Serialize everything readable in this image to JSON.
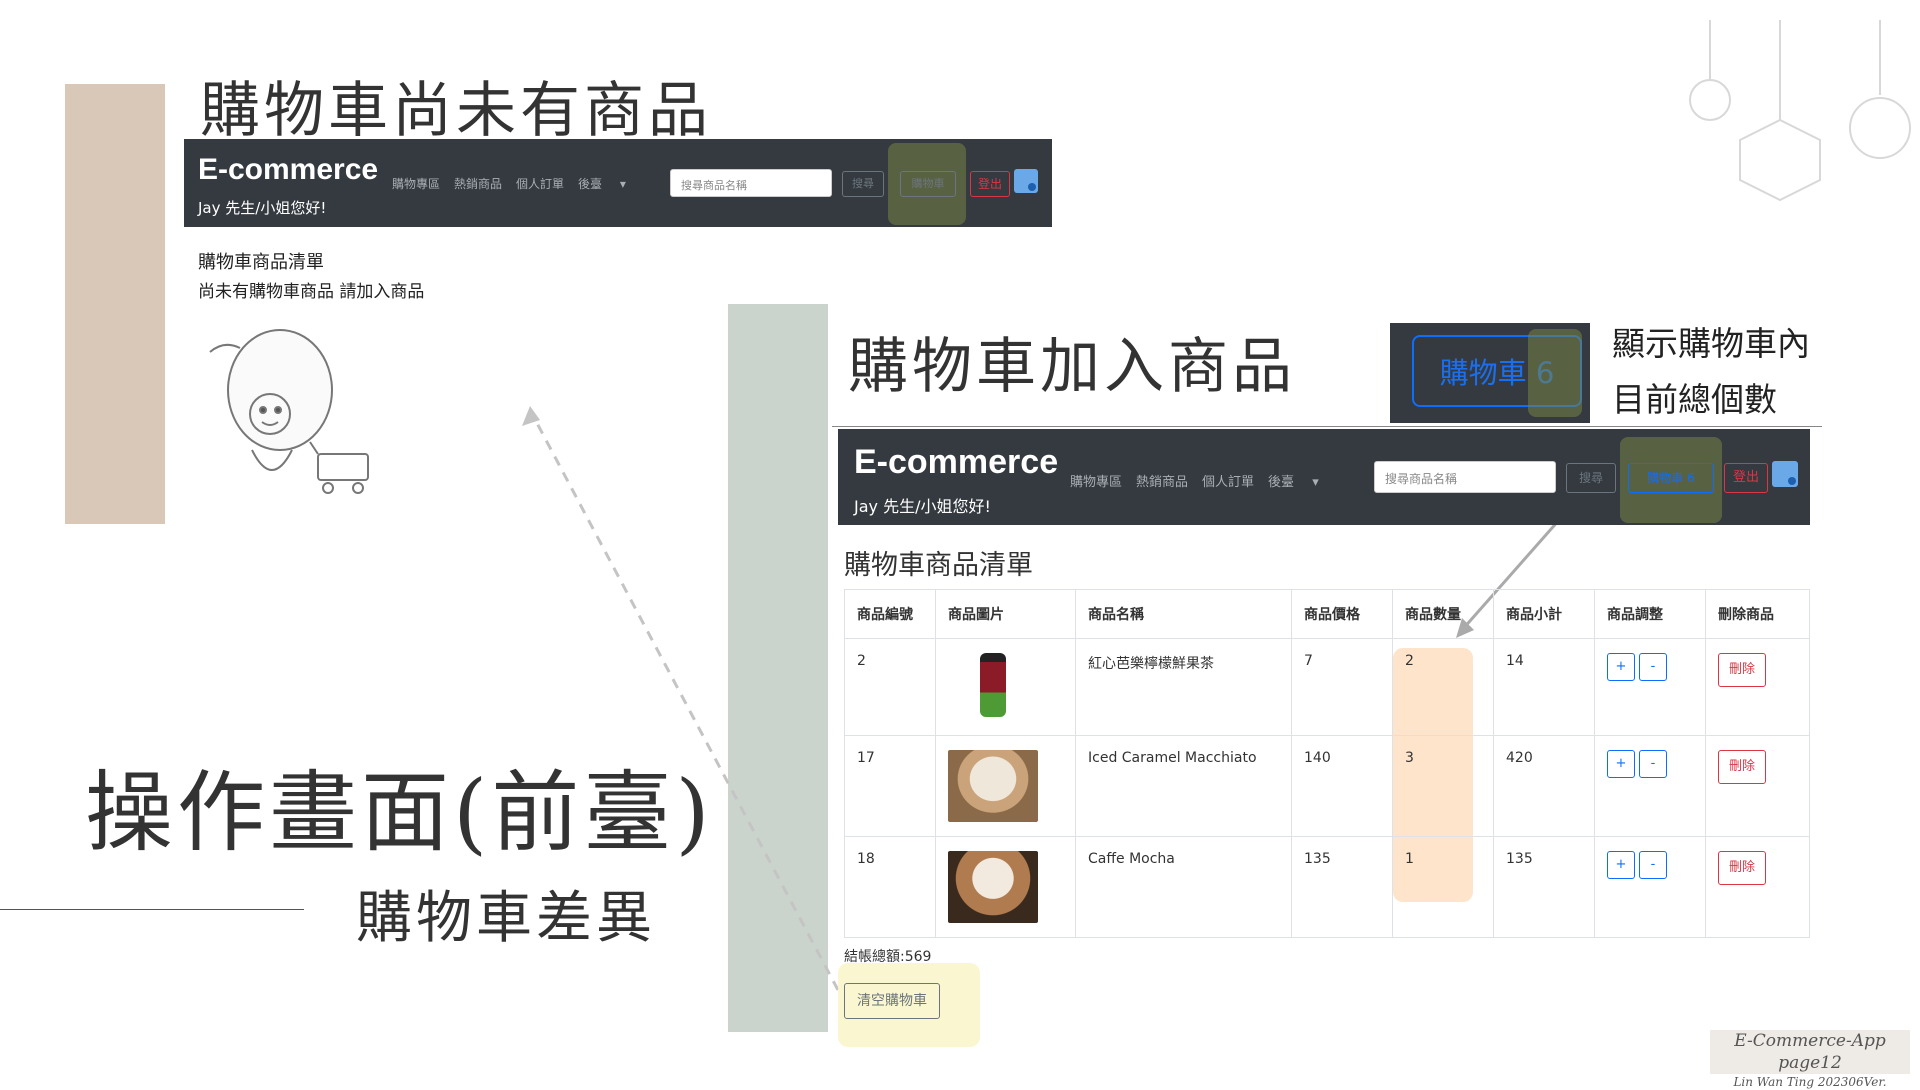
{
  "slide": {
    "title_empty": "購物車尚未有商品",
    "title_added": "購物車加入商品",
    "title_main": "操作畫面(前臺)",
    "subtitle": "購物車差異",
    "callout_line1": "顯示購物車內",
    "callout_line2": "目前總個數",
    "footer_line1": "E-Commerce-App page12",
    "footer_line2": "Lin Wan Ting 202306Ver."
  },
  "navbar": {
    "brand": "E-commerce",
    "greeting": "Jay 先生/小姐您好!",
    "links": [
      "購物專區",
      "熱銷商品",
      "個人訂單",
      "後臺"
    ],
    "search_placeholder": "搜尋商品名稱",
    "search_button": "搜尋",
    "cart_button_empty": "購物車",
    "cart_button_filled": "購物車 6",
    "logout_button": "登出"
  },
  "empty_cart": {
    "heading": "購物車商品清單",
    "message": "尚未有購物車商品 請加入商品"
  },
  "callout": {
    "cart_badge": "購物車 6"
  },
  "cart": {
    "heading": "購物車商品清單",
    "columns": [
      "商品編號",
      "商品圖片",
      "商品名稱",
      "商品價格",
      "商品數量",
      "商品小計",
      "商品調整",
      "刪除商品"
    ],
    "rows": [
      {
        "id": "2",
        "image": "bottle-drink",
        "name": "紅心芭樂檸檬鮮果茶",
        "price": "7",
        "qty": "2",
        "subtotal": "14"
      },
      {
        "id": "17",
        "image": "iced-latte",
        "name": "Iced Caramel Macchiato",
        "price": "140",
        "qty": "3",
        "subtotal": "420"
      },
      {
        "id": "18",
        "image": "mocha-cup",
        "name": "Caffe Mocha",
        "price": "135",
        "qty": "1",
        "subtotal": "135"
      }
    ],
    "plus_label": "+",
    "minus_label": "-",
    "delete_label": "刪除",
    "total": "結帳總額:569",
    "clear_button": "清空購物車"
  },
  "colors": {
    "navbar_bg": "#343a40",
    "primary": "#0d6efd",
    "danger": "#dc3545",
    "secondary": "#6c757d"
  }
}
